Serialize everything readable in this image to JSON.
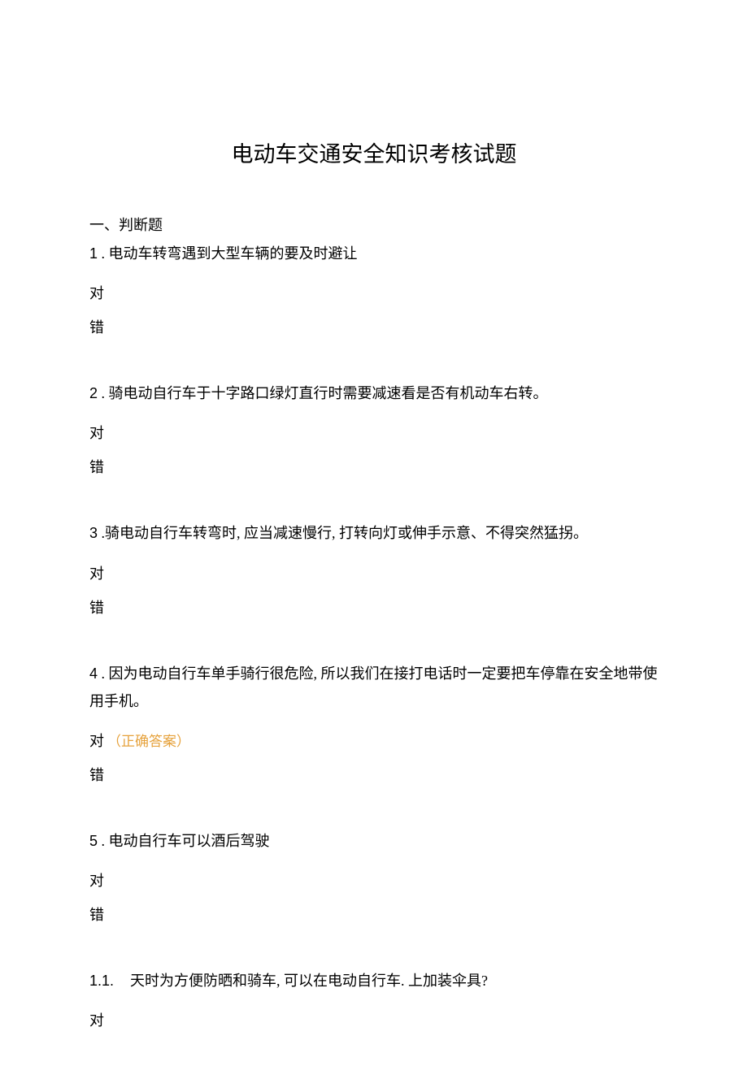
{
  "title": "电动车交通安全知识考核试题",
  "section": "一、判断题",
  "questions": [
    {
      "num": "1",
      "sep": " . ",
      "text": "电动车转弯遇到大型车辆的要及时避让",
      "opt1": "对",
      "opt2": "错",
      "answerOn": ""
    },
    {
      "num": "2",
      "sep": " . ",
      "text": "骑电动自行车于十字路口绿灯直行时需要减速看是否有机动车右转。",
      "opt1": "对",
      "opt2": "错",
      "answerOn": ""
    },
    {
      "num": "3",
      "sep": " .",
      "text": "骑电动自行车转弯时, 应当减速慢行, 打转向灯或伸手示意、不得突然猛拐。",
      "opt1": "对",
      "opt2": "错",
      "answerOn": ""
    },
    {
      "num": "4",
      "sep": " . ",
      "text": "因为电动自行车单手骑行很危险, 所以我们在接打电话时一定要把车停靠在安全地带使用手机。",
      "opt1": "对",
      "opt2": "错",
      "answerOn": "opt1",
      "answerTag": "（正确答案）"
    },
    {
      "num": "5",
      "sep": " . ",
      "text": "电动自行车可以酒后驾驶",
      "opt1": "对",
      "opt2": "错",
      "answerOn": ""
    },
    {
      "num": "1.1.",
      "sep": "    ",
      "text": "天时为方便防晒和骑车, 可以在电动自行车. 上加装伞具?",
      "opt1": "对",
      "opt2": "",
      "answerOn": ""
    }
  ]
}
